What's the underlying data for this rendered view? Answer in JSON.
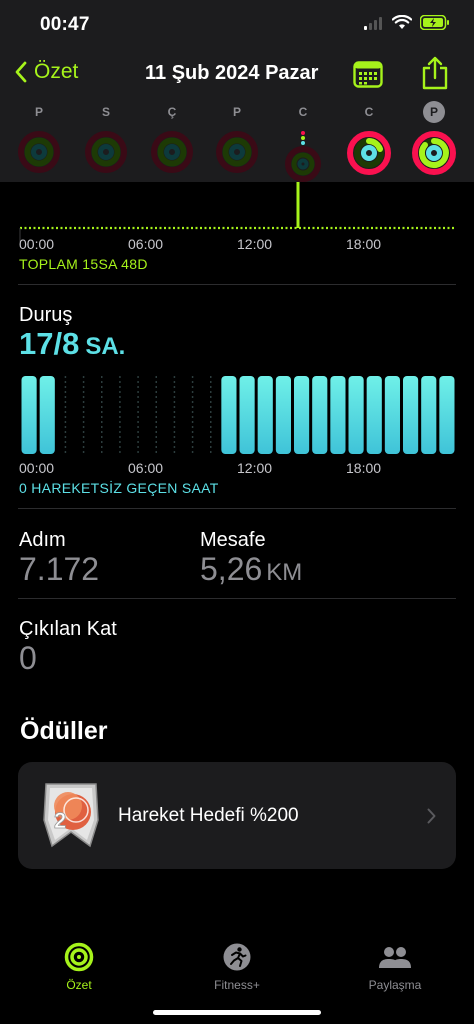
{
  "status": {
    "time": "00:47"
  },
  "nav": {
    "back_label": "Özet",
    "title": "11 Şub 2024 Pazar"
  },
  "week": [
    {
      "letter": "P"
    },
    {
      "letter": "S"
    },
    {
      "letter": "Ç"
    },
    {
      "letter": "P"
    },
    {
      "letter": "C"
    },
    {
      "letter": "C"
    },
    {
      "letter": "P"
    }
  ],
  "timeline": {
    "ticks": [
      "00:00",
      "06:00",
      "12:00",
      "18:00"
    ],
    "total_label": "TOPLAM 15SA 48D"
  },
  "stand": {
    "title": "Duruş",
    "value": "17/8",
    "unit": "SA.",
    "ticks": [
      "00:00",
      "06:00",
      "12:00",
      "18:00"
    ],
    "footer": "0 HAREKETSİZ GEÇEN SAAT",
    "hours": [
      1,
      1,
      0,
      0,
      0,
      0,
      0,
      0,
      0,
      0,
      0,
      1,
      1,
      1,
      1,
      1,
      1,
      1,
      1,
      1,
      1,
      1,
      1,
      1
    ]
  },
  "stats": {
    "steps_label": "Adım",
    "steps_value": "7.172",
    "distance_label": "Mesafe",
    "distance_value": "5,26",
    "distance_unit": "KM",
    "floors_label": "Çıkılan Kat",
    "floors_value": "0"
  },
  "awards": {
    "title": "Ödüller",
    "item_label": "Hareket Hedefi %200"
  },
  "tabs": {
    "summary": "Özet",
    "fitness": "Fitness+",
    "sharing": "Paylaşma"
  },
  "colors": {
    "accent_green": "#a6f31b",
    "stand_cyan": "#5de0e6",
    "move_red": "#fa114f"
  }
}
